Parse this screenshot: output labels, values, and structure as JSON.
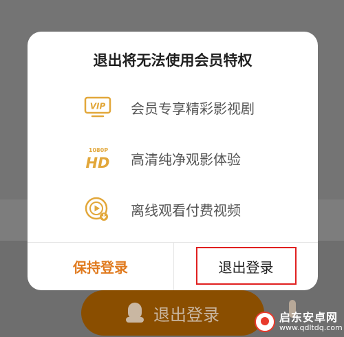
{
  "dialog": {
    "title": "退出将无法使用会员特权",
    "benefits": [
      {
        "icon": "vip-icon",
        "label": "会员专享精彩影视剧"
      },
      {
        "icon": "hd-1080p-icon",
        "label": "高清纯净观影体验"
      },
      {
        "icon": "offline-play-icon",
        "label": "离线观看付费视频"
      }
    ],
    "stay_button": "保持登录",
    "logout_button": "退出登录"
  },
  "icon_text": {
    "vip": "VIP",
    "hd": "HD",
    "hd_res": "1080P"
  },
  "background": {
    "login_button": "退出登录"
  },
  "watermark": {
    "name": "启东安卓网",
    "url": "www.qdltdq.com"
  },
  "colors": {
    "accent": "#e07a1e",
    "icon_gold": "#e2a73a",
    "highlight": "#e02020"
  }
}
